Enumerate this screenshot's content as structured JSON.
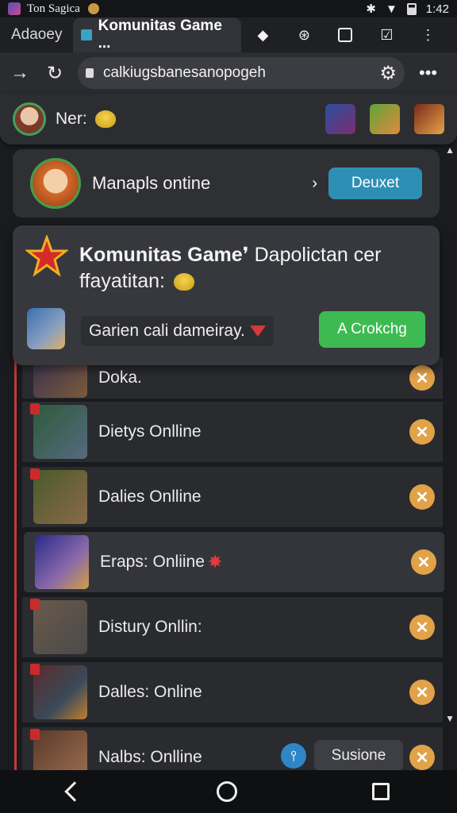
{
  "status_bar": {
    "app_title": "Ton Sagica",
    "time": "1:42"
  },
  "tabs": [
    {
      "label": "Adaoey"
    },
    {
      "label": "Komunitas Game ..."
    }
  ],
  "url_bar": {
    "url": "calkiugsbanesanopogeh"
  },
  "profile": {
    "name": "Ner:"
  },
  "online_card": {
    "text": "Manapls ontine",
    "button_label": "Deuxet"
  },
  "popup": {
    "title_bold": "Komunitas Game",
    "title_rest": "Dapolictan cer",
    "subtitle": "ffayatitan:",
    "note": "Garien cali dameiray.",
    "button_label": "A Crokchg"
  },
  "list": [
    {
      "title": "Doka."
    },
    {
      "title": "Dietys Onlline"
    },
    {
      "title": "Dalies Onlline"
    },
    {
      "title": "Eraps: Onliine"
    },
    {
      "title": "Distury Onllin:"
    },
    {
      "title": "Dalles: Online"
    },
    {
      "title": "Nalbs: Onlline",
      "action_label": "Susione"
    }
  ],
  "colors": {
    "accent_blue": "#2e8fb5",
    "accent_green": "#3dbb52",
    "close_orange": "#e1a248"
  }
}
